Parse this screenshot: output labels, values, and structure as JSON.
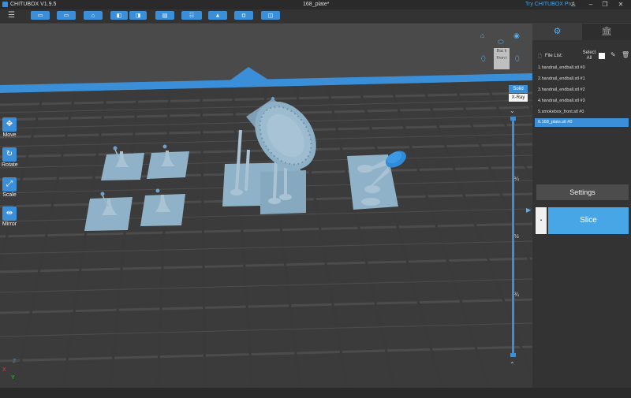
{
  "app": {
    "title": "CHITUBOX V1.9.5",
    "document": "168_plate*",
    "try_pro": "Try CHITUBOX Pro"
  },
  "window_controls": {
    "minimize": "–",
    "restore": "❐",
    "close": "✕",
    "user": "♙"
  },
  "toolbar": {
    "menu_icon": "☰",
    "buttons": [
      {
        "name": "open-file",
        "glyph": "▭"
      },
      {
        "name": "save",
        "glyph": "▭"
      },
      {
        "name": "workspace",
        "glyph": "⌂"
      },
      {
        "name": "undo",
        "glyph": "◧"
      },
      {
        "name": "redo",
        "glyph": "◨"
      },
      {
        "name": "settings",
        "glyph": "▤"
      },
      {
        "name": "network",
        "glyph": "☷"
      },
      {
        "name": "support",
        "glyph": "▲"
      },
      {
        "name": "fit",
        "glyph": "◘"
      },
      {
        "name": "machine",
        "glyph": "◫"
      }
    ]
  },
  "left_tools": [
    {
      "label": "Move",
      "glyph": "✥"
    },
    {
      "label": "Rotate",
      "glyph": "↻"
    },
    {
      "label": "Scale",
      "glyph": "⤢"
    },
    {
      "label": "Mirror",
      "glyph": "⇹"
    }
  ],
  "view_modes": {
    "solid": "Solid",
    "xray": "X-Ray"
  },
  "viewcube": {
    "top": "Bac k",
    "bottom": "Fron t"
  },
  "layer_slider": {
    "marks": [
      "¼",
      "½",
      "¾"
    ]
  },
  "right_panel": {
    "file_list_label": "File List:",
    "select_all_label": "Select All",
    "files": [
      "1.handrail_endball.stl #0",
      "2.handrail_endball.stl #1",
      "3.handrail_endball.stl #2",
      "4.handrail_endball.stl #3",
      "5.smokebox_front.stl #0",
      "6.168_plate.stl #0"
    ],
    "selected_index": 5,
    "settings_label": "Settings",
    "slice_label": "Slice",
    "slice_side": "▪"
  },
  "axes": {
    "x": "X",
    "y": "Y",
    "z": "Z"
  },
  "colors": {
    "accent": "#3a8fd8",
    "viewport": "#4a4a4a",
    "model": "#8fb2c8"
  }
}
